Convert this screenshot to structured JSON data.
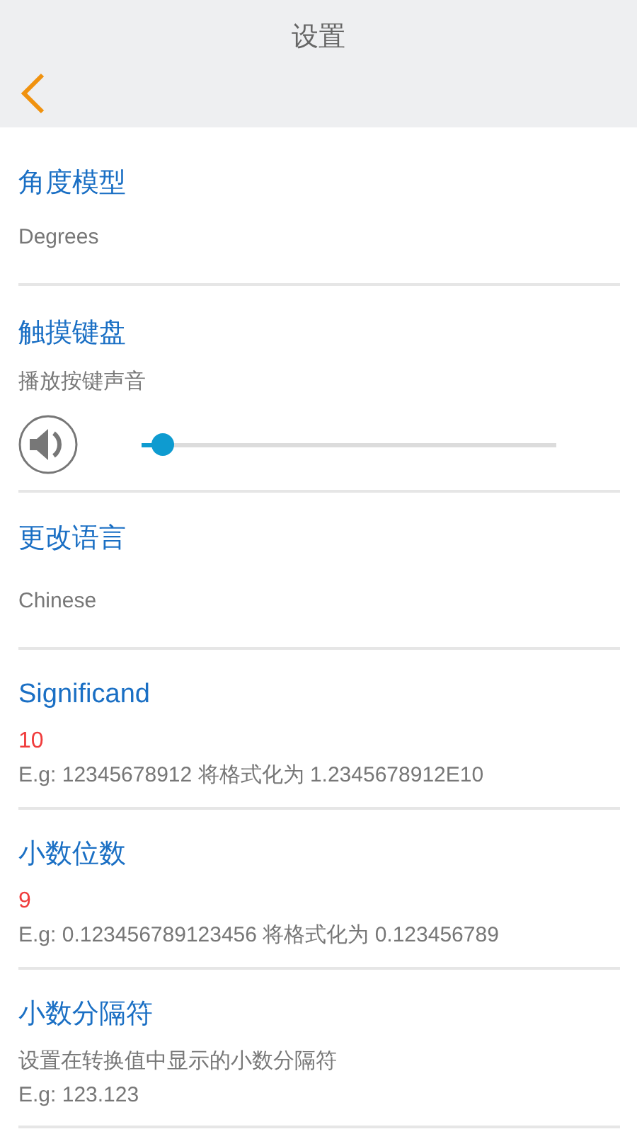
{
  "header": {
    "title": "设置"
  },
  "sections": [
    {
      "kind": "value",
      "title": "角度模型",
      "value": "Degrees"
    },
    {
      "kind": "slider",
      "title": "触摸键盘",
      "subtitle": "播放按键声音",
      "level": 0.05
    },
    {
      "kind": "value",
      "title": "更改语言",
      "value": "Chinese"
    },
    {
      "kind": "number",
      "title": "Significand",
      "value": "10",
      "example": "E.g: 12345678912 将格式化为 1.2345678912E10"
    },
    {
      "kind": "number",
      "title": "小数位数",
      "value": "9",
      "example": "E.g: 0.123456789123456 将格式化为 0.123456789"
    },
    {
      "kind": "note",
      "title": "小数分隔符",
      "description": "设置在转换值中显示的小数分隔符",
      "example": "E.g: 123.123"
    }
  ]
}
